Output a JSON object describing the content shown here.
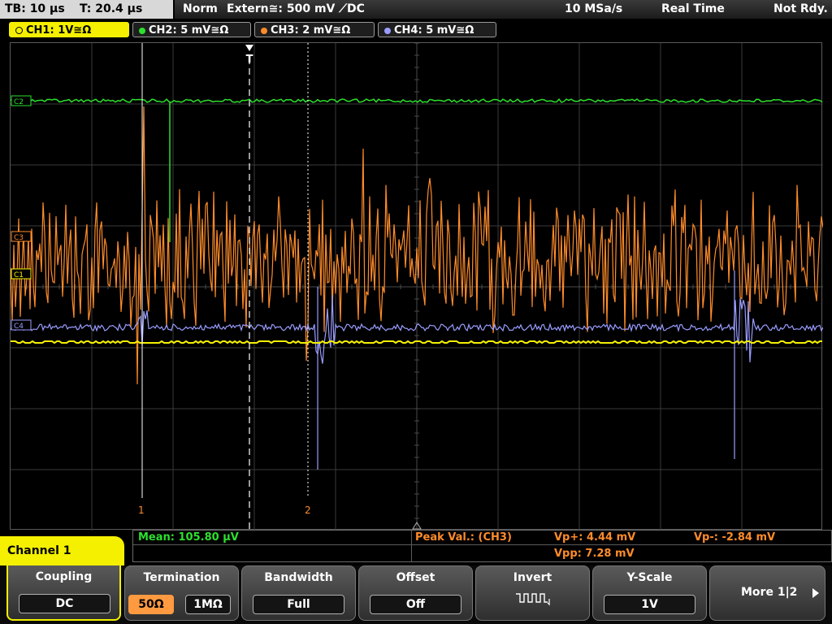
{
  "status": {
    "timebase": "TB: 10 µs",
    "trigger_time": "T: 20.4 µs",
    "acq_mode": "Norm",
    "trigger_source": "Extern≅: 500 mV ⟋DC",
    "sample_rate": "10 MSa/s",
    "mode": "Real Time",
    "state": "Not Rdy."
  },
  "channels": [
    {
      "label": "CH1: 1V≅Ω",
      "color": "#f4f000",
      "active": true
    },
    {
      "label": "CH2: 5 mV≅Ω",
      "color": "#2de02d",
      "active": false
    },
    {
      "label": "CH3: 2 mV≅Ω",
      "color": "#ff8c2a",
      "active": false
    },
    {
      "label": "CH4: 5 mV≅Ω",
      "color": "#9a9cff",
      "active": false
    }
  ],
  "trace_labels": {
    "c2": "C2",
    "c3": "C3",
    "c1": "C1",
    "c4": "C4"
  },
  "markers": {
    "m1": "1",
    "m2": "2",
    "trigger": "T"
  },
  "measurements": {
    "mean": "Mean: 105.80 µV",
    "peak_label": "Peak Val.:  (CH3)",
    "vp_plus": "Vp+: 4.44 mV",
    "vp_minus": "Vp-: -2.84 mV",
    "vpp": "Vpp: 7.28 mV"
  },
  "panel_title": "Channel 1",
  "softkeys": {
    "coupling": {
      "title": "Coupling",
      "value": "DC"
    },
    "termination": {
      "title": "Termination",
      "opt1": "50Ω",
      "opt2": "1MΩ"
    },
    "bandwidth": {
      "title": "Bandwidth",
      "value": "Full"
    },
    "offset": {
      "title": "Offset",
      "value": "Off"
    },
    "invert": {
      "title": "Invert"
    },
    "yscale": {
      "title": "Y-Scale",
      "value": "1V"
    },
    "more": {
      "title": "More 1|2"
    }
  },
  "icons": {
    "invert": "invert-waveform-icon",
    "more": "play-arrow-icon"
  }
}
